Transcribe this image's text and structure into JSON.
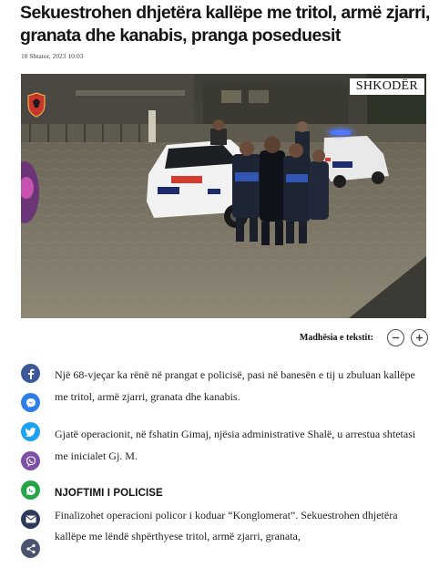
{
  "article": {
    "title": "Sekuestrohen dhjetëra kallëpe me tritol, armë zjarri, granata dhe kanabis, pranga poseduesit",
    "date": "18 Shtator, 2023 10:03",
    "image_watermark": "SHKODËR",
    "image_crest_icon": "police-crest-icon"
  },
  "font_size_control": {
    "label": "Madhësia e tekstit:",
    "decrease_icon": "minus-icon",
    "increase_icon": "plus-icon"
  },
  "share_bar": [
    {
      "name": "facebook",
      "icon": "facebook-icon",
      "color": "#3b5998"
    },
    {
      "name": "messenger",
      "icon": "messenger-icon",
      "color": "#2f7de8"
    },
    {
      "name": "twitter",
      "icon": "twitter-icon",
      "color": "#1da1f2"
    },
    {
      "name": "viber",
      "icon": "viber-icon",
      "color": "#7d4fa6"
    },
    {
      "name": "whatsapp",
      "icon": "whatsapp-icon",
      "color": "#25a548"
    },
    {
      "name": "email",
      "icon": "email-icon",
      "color": "#2e3a5c"
    },
    {
      "name": "more",
      "icon": "share-icon",
      "color": "#4a5470"
    }
  ],
  "body": {
    "p1": "Një 68-vjeçar ka rënë në prangat e policisë, pasi në banesën e tij u zbuluan kallëpe me tritol, armë zjarri, granata dhe kanabis.",
    "p2": "Gjatë operacionit, në fshatin Gimaj, njësia administrative Shalë, u arrestua shtetasi me inicialet Gj. M.",
    "heading": "NJOFTIMI I POLICISE",
    "p3": "Finalizohet operacioni policor i koduar “Konglomerat”. Sekuestrohen dhjetëra kallëpe me lëndë shpërthyese tritol, armë zjarri, granata,"
  }
}
